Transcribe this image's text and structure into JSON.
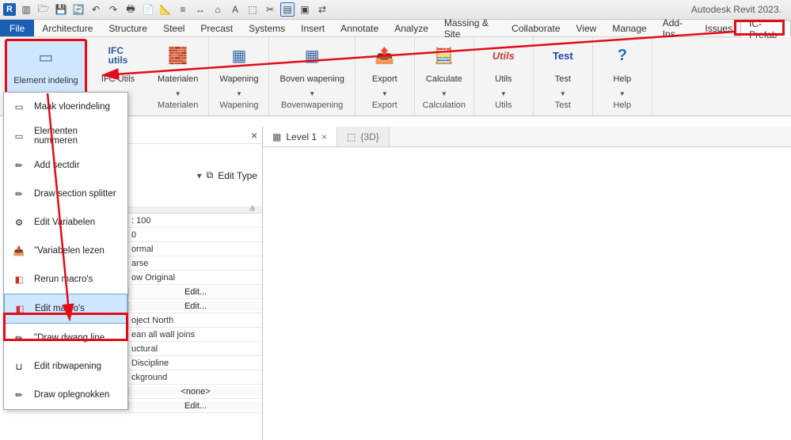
{
  "app": {
    "title": "Autodesk Revit 2023."
  },
  "menutabs": {
    "file": "File",
    "items": [
      "Architecture",
      "Structure",
      "Steel",
      "Precast",
      "Systems",
      "Insert",
      "Annotate",
      "Analyze",
      "Massing & Site",
      "Collaborate",
      "View",
      "Manage",
      "Add-Ins",
      "Issues",
      "IC-Prefab"
    ],
    "active": "IC-Prefab"
  },
  "ribbon": {
    "groups": [
      {
        "name": "",
        "buttons": [
          {
            "label": "Element indeling",
            "icon": "▭",
            "dropdown": true,
            "highlight": true
          }
        ]
      },
      {
        "name": "",
        "buttons": [
          {
            "label": "IFC Utils",
            "icon_text": "IFC\nutils",
            "dropdown": true
          }
        ]
      },
      {
        "name": "Materialen",
        "buttons": [
          {
            "label": "Materialen",
            "icon": "🧱",
            "dropdown": true
          }
        ]
      },
      {
        "name": "Wapening",
        "buttons": [
          {
            "label": "Wapening",
            "icon": "▦",
            "dropdown": true
          }
        ]
      },
      {
        "name": "Bovenwapening",
        "buttons": [
          {
            "label": "Boven wapening",
            "icon": "▦",
            "dropdown": true
          }
        ]
      },
      {
        "name": "Export",
        "buttons": [
          {
            "label": "Export",
            "icon": "📄",
            "dropdown": true
          }
        ]
      },
      {
        "name": "Calculation",
        "buttons": [
          {
            "label": "Calculate",
            "icon": "🧮",
            "dropdown": true
          }
        ]
      },
      {
        "name": "Utils",
        "buttons": [
          {
            "label": "Utils",
            "icon_text": "Utils",
            "color": "#c73a3a",
            "dropdown": true
          }
        ]
      },
      {
        "name": "Test",
        "buttons": [
          {
            "label": "Test",
            "icon_text": "Test",
            "color": "#1f3fbd",
            "dropdown": true
          }
        ]
      },
      {
        "name": "Help",
        "buttons": [
          {
            "label": "Help",
            "icon": "?",
            "dropdown": true
          }
        ]
      }
    ]
  },
  "dropdown": {
    "items": [
      {
        "label": "Maak vloerindeling",
        "icon": "▭"
      },
      {
        "label": "Elementen nummeren",
        "icon": "▭"
      },
      {
        "label": "Add sectdir",
        "icon": "✏"
      },
      {
        "label": "Draw section splitter",
        "icon": "✏"
      },
      {
        "label": "Edit Variabelen",
        "icon": "⚙"
      },
      {
        "label": "\"Variabelen lezen",
        "icon": "📥"
      },
      {
        "label": "Rerun macro's",
        "icon": "⬛"
      },
      {
        "label": "Edit macro's",
        "icon": "⬛",
        "highlight": true
      },
      {
        "label": "\"Draw dwang line",
        "icon": "✏"
      },
      {
        "label": "Edit ribwapening",
        "icon": "⊔"
      },
      {
        "label": "Draw oplegnokken",
        "icon": "✏"
      }
    ]
  },
  "props": {
    "edit_type": "Edit Type",
    "rows_pre": [
      {
        "val": ": 100"
      },
      {
        "val": "0"
      },
      {
        "val": "ormal"
      },
      {
        "val": "arse"
      },
      {
        "val": "ow Original"
      }
    ],
    "edit_label1": "Edit...",
    "edit_label2": "Edit...",
    "rows_mid": [
      {
        "val": "oject North"
      },
      {
        "val": "ean all wall joins"
      },
      {
        "val": "uctural"
      },
      {
        "val": "Discipline"
      },
      {
        "val": "ckground"
      }
    ],
    "none_label": "<none>",
    "edit_label3": "Edit..."
  },
  "viewtabs": {
    "tabs": [
      {
        "label": "Level 1",
        "active": true,
        "icon": "▦"
      },
      {
        "label": "{3D}",
        "active": false,
        "icon": "⬚"
      }
    ]
  }
}
